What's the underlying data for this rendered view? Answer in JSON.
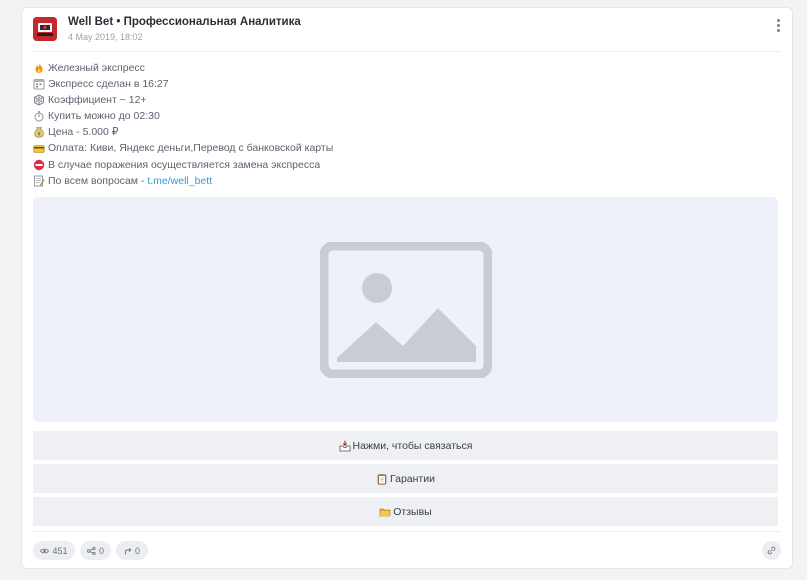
{
  "post": {
    "channel_name": "Well Bet • Профессиональная Аналитика",
    "date": "4 May 2019, 18:02",
    "lines": [
      {
        "icon": "fire-icon",
        "text": "Железный экспресс"
      },
      {
        "icon": "calendar-icon",
        "text": "Экспресс сделан в 16:27"
      },
      {
        "icon": "dice-icon",
        "text": "Коэффициент ~ 12+"
      },
      {
        "icon": "stopwatch-icon",
        "text": "Купить можно до 02:30"
      },
      {
        "icon": "money-bag-icon",
        "text": "Цена - 5.000 ₽"
      },
      {
        "icon": "credit-card-icon",
        "text": "Оплата: Киви, Яндекс деньги,Перевод с банковской карты"
      },
      {
        "icon": "no-entry-icon",
        "text": "В случае поражения осуществляется замена экспресса"
      },
      {
        "icon": "memo-icon",
        "text": "По всем вопросам - ",
        "link": "t.me/well_bett"
      }
    ]
  },
  "buttons": [
    {
      "icon": "inbox-tray-icon",
      "label": "Нажми, чтобы связаться"
    },
    {
      "icon": "clipboard-icon",
      "label": "Гарантии"
    },
    {
      "icon": "folder-icon",
      "label": "Отзывы"
    }
  ],
  "stats": {
    "views": "451",
    "shares": "0",
    "forwards": "0"
  },
  "colors": {
    "accent_link": "#2f9bd6",
    "avatar_bg": "#c6262e",
    "image_placeholder": "#eef1f9"
  }
}
